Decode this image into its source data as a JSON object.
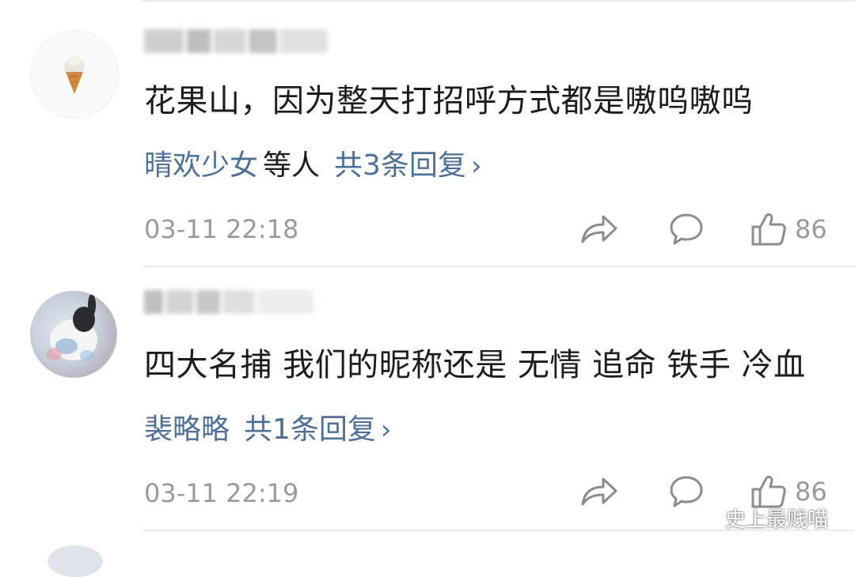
{
  "comments": [
    {
      "username": "",
      "text": "花果山，因为整天打招呼方式都是嗷呜嗷呜",
      "reply_names": "晴欢少女",
      "reply_others": "等人",
      "reply_count": "共3条回复",
      "reply_chevron": "›",
      "timestamp": "03-11 22:18",
      "likes": "86",
      "avatar_icon": "ice-cream-icon"
    },
    {
      "username": "",
      "text": "四大名捕 我们的昵称还是 无情 追命 铁手 冷血",
      "reply_names": "裴略略",
      "reply_count": "共1条回复",
      "reply_chevron": "›",
      "timestamp": "03-11 22:19",
      "likes": "86",
      "avatar_icon": "rabbit-photo"
    }
  ],
  "watermark": {
    "text": "史上最贱喵",
    "icon": "wechat-icon"
  },
  "colors": {
    "link": "#4d6f9a",
    "muted": "#9a9a9a",
    "text": "#1c1c1c"
  }
}
